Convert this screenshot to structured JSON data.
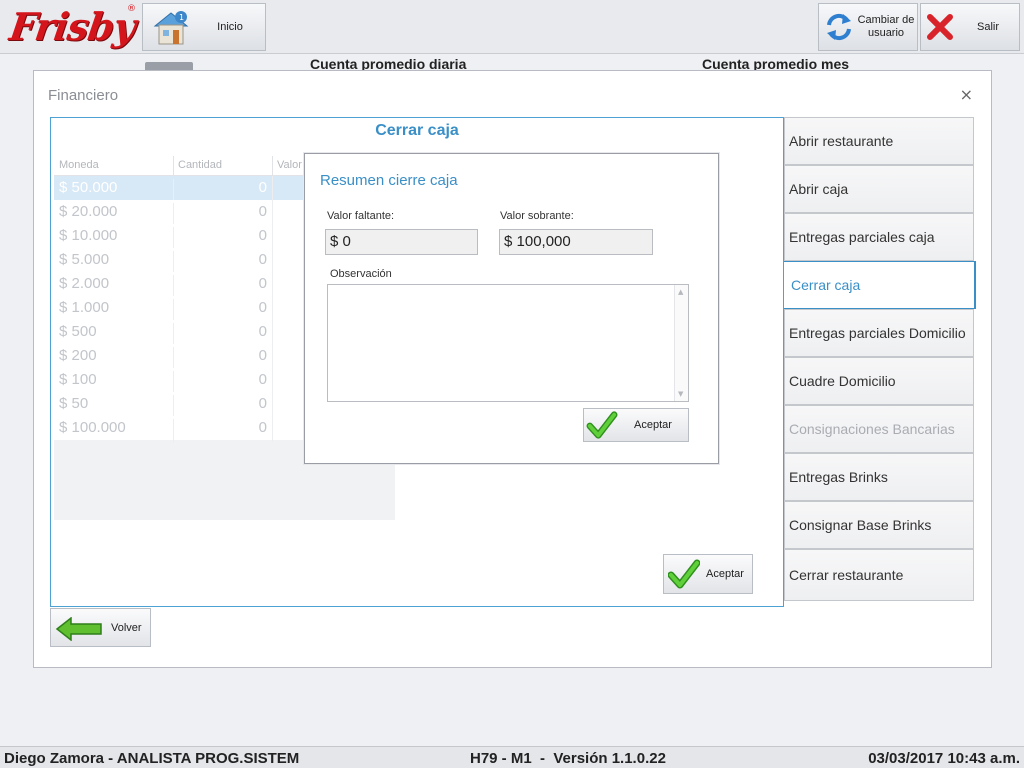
{
  "app": {
    "logo_text": "Frisby",
    "logo_mark": "®"
  },
  "toolbar": {
    "inicio_label": "Inicio",
    "cambiar_usuario_label": "Cambiar de usuario",
    "salir_label": "Salir"
  },
  "background": {
    "heading_left": "Cuenta promedio diaria",
    "heading_right": "Cuenta promedio mes"
  },
  "financiero": {
    "title": "Financiero",
    "close_glyph": "×",
    "panel_title": "Cerrar caja",
    "grid": {
      "headers": [
        "Moneda",
        "Cantidad",
        "Valor"
      ],
      "rows": [
        {
          "moneda": "$ 50.000",
          "cantidad": "0"
        },
        {
          "moneda": "$ 20.000",
          "cantidad": "0"
        },
        {
          "moneda": "$ 10.000",
          "cantidad": "0"
        },
        {
          "moneda": "$ 5.000",
          "cantidad": "0"
        },
        {
          "moneda": "$ 2.000",
          "cantidad": "0"
        },
        {
          "moneda": "$ 1.000",
          "cantidad": "0"
        },
        {
          "moneda": "$ 500",
          "cantidad": "0"
        },
        {
          "moneda": "$ 200",
          "cantidad": "0"
        },
        {
          "moneda": "$ 100",
          "cantidad": "0"
        },
        {
          "moneda": "$ 50",
          "cantidad": "0"
        },
        {
          "moneda": "$ 100.000",
          "cantidad": "0"
        }
      ]
    },
    "aceptar_label": "Aceptar",
    "volver_label": "Volver"
  },
  "menu": {
    "items": [
      {
        "label": "Abrir restaurante",
        "state": "normal"
      },
      {
        "label": "Abrir caja",
        "state": "normal"
      },
      {
        "label": "Entregas parciales caja",
        "state": "normal"
      },
      {
        "label": "Cerrar caja",
        "state": "active"
      },
      {
        "label": "Entregas parciales Domicilio",
        "state": "normal"
      },
      {
        "label": "Cuadre Domicilio",
        "state": "normal"
      },
      {
        "label": "Consignaciones Bancarias",
        "state": "disabled"
      },
      {
        "label": "Entregas Brinks",
        "state": "normal"
      },
      {
        "label": "Consignar Base Brinks",
        "state": "normal"
      },
      {
        "label": "Cerrar restaurante",
        "state": "normal"
      }
    ]
  },
  "modal": {
    "title": "Resumen cierre caja",
    "valor_faltante_label": "Valor faltante:",
    "valor_faltante": "$ 0",
    "valor_sobrante_label": "Valor sobrante:",
    "valor_sobrante": "$ 100,000",
    "observacion_label": "Observación",
    "observacion": "",
    "aceptar_label": "Aceptar"
  },
  "status": {
    "user": "Diego Zamora - ANALISTA PROG.SISTEM",
    "version": "H79 - M1  -  Versión 1.1.0.22",
    "datetime": "03/03/2017 10:43 a.m."
  },
  "colors": {
    "accent": "#3a8fc7",
    "brand_red": "#d4161c",
    "check_green": "#3fae2a"
  },
  "icons": {
    "inicio": "house-icon",
    "cambiar": "swap-arrows-icon",
    "salir": "close-x-icon",
    "aceptar": "checkmark-icon",
    "volver": "back-arrow-icon"
  }
}
